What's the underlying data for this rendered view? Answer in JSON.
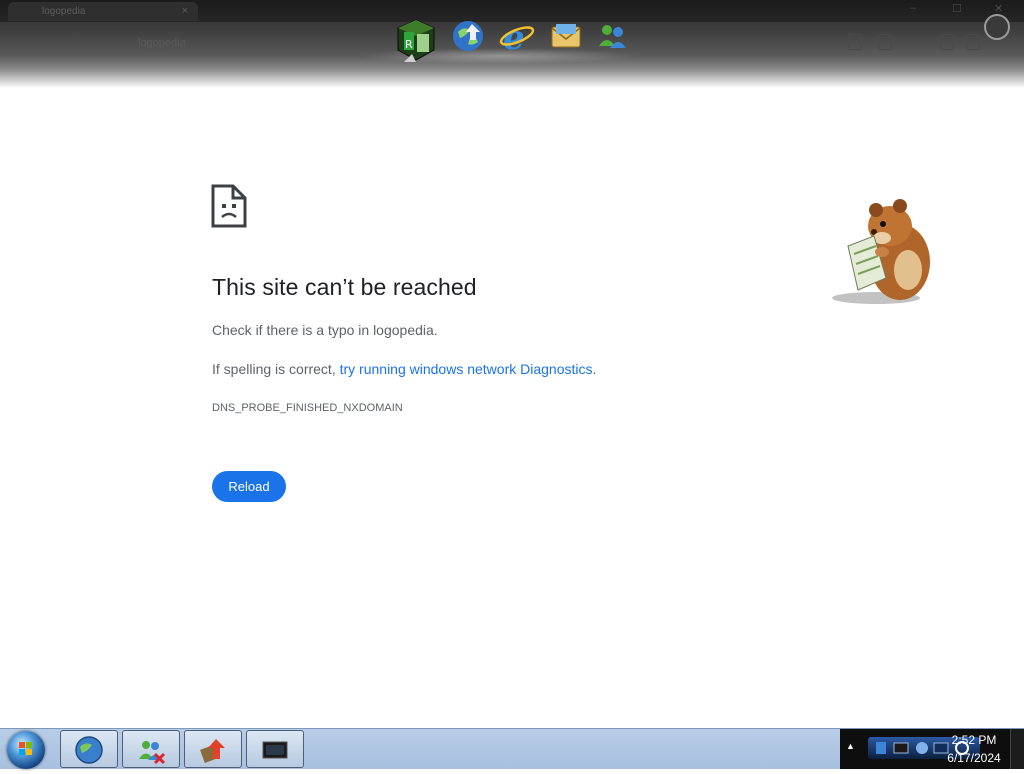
{
  "browser": {
    "tab_title": "logopedia",
    "tab_close": "×",
    "address": "logopedia",
    "window_controls": [
      "–",
      "☐",
      "✕"
    ],
    "toolbar": [
      "←",
      "→",
      "⟳"
    ]
  },
  "dock": {
    "icons": [
      "winrar-icon",
      "globe-download-icon",
      "internet-explorer-icon",
      "mail-envelope-icon",
      "messenger-people-icon"
    ]
  },
  "error_page": {
    "title": "This site can’t be reached",
    "check_text": "Check if there is a typo in logopedia.",
    "spelling_prefix": "If spelling is correct, ",
    "diagnostics_link": "try running windows network Diagnostics",
    "spelling_suffix": ".",
    "error_code": "DNS_PROBE_FINISHED_NXDOMAIN",
    "reload_label": "Reload"
  },
  "taskbar": {
    "pinned": [
      "browser-globe-icon",
      "messenger-error-icon",
      "update-arrow-icon",
      "monitor-icon"
    ],
    "tray_arrow": "▲",
    "clock_time": "2:52 PM",
    "clock_date": "6/17/2024"
  },
  "colors": {
    "link": "#1a73e8",
    "button": "#1a73e8",
    "heading": "#202124",
    "body_text": "#5f6368",
    "taskbar": "#b8cde6"
  }
}
